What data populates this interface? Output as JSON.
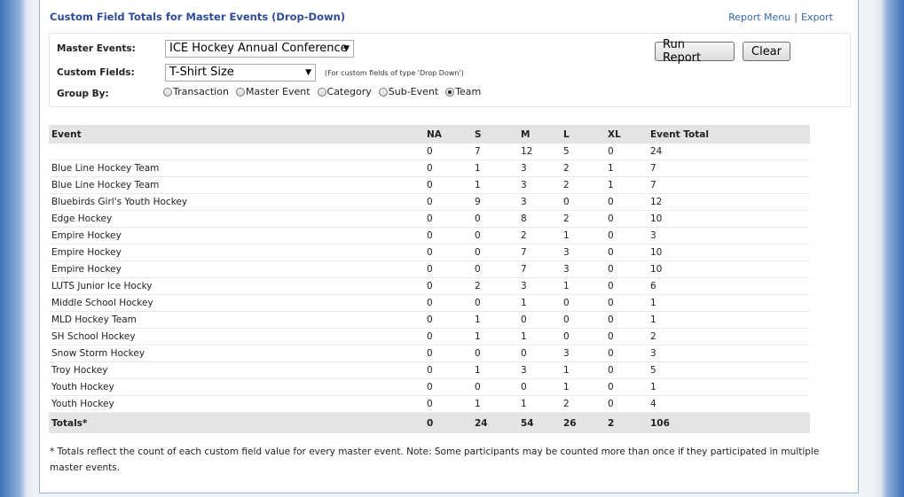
{
  "header": {
    "title": "Custom Field Totals for Master Events (Drop-Down)",
    "report_menu": "Report Menu",
    "separator": "|",
    "export": "Export"
  },
  "filters": {
    "master_events_label": "Master Events:",
    "master_events_value": "ICE Hockey Annual Conference",
    "custom_fields_label": "Custom Fields:",
    "custom_fields_value": "T-Shirt Size",
    "custom_fields_note": "(For custom fields of type 'Drop Down')",
    "group_by_label": "Group By:",
    "group_by_options": [
      "Transaction",
      "Master Event",
      "Category",
      "Sub-Event",
      "Team"
    ],
    "group_by_selected": "Team",
    "run_report": "Run Report",
    "clear": "Clear"
  },
  "table": {
    "columns": [
      "Event",
      "NA",
      "S",
      "M",
      "L",
      "XL",
      "Event Total"
    ],
    "rows": [
      [
        "",
        "0",
        "7",
        "12",
        "5",
        "0",
        "24"
      ],
      [
        "Blue Line Hockey Team",
        "0",
        "1",
        "3",
        "2",
        "1",
        "7"
      ],
      [
        "Blue Line Hockey Team",
        "0",
        "1",
        "3",
        "2",
        "1",
        "7"
      ],
      [
        "Bluebirds Girl's Youth Hockey",
        "0",
        "9",
        "3",
        "0",
        "0",
        "12"
      ],
      [
        "Edge Hockey",
        "0",
        "0",
        "8",
        "2",
        "0",
        "10"
      ],
      [
        "Empire Hockey",
        "0",
        "0",
        "2",
        "1",
        "0",
        "3"
      ],
      [
        "Empire Hockey",
        "0",
        "0",
        "7",
        "3",
        "0",
        "10"
      ],
      [
        "Empire Hockey",
        "0",
        "0",
        "7",
        "3",
        "0",
        "10"
      ],
      [
        "LUTS Junior Ice Hocky",
        "0",
        "2",
        "3",
        "1",
        "0",
        "6"
      ],
      [
        "Middle School Hockey",
        "0",
        "0",
        "1",
        "0",
        "0",
        "1"
      ],
      [
        "MLD Hockey Team",
        "0",
        "1",
        "0",
        "0",
        "0",
        "1"
      ],
      [
        "SH School Hockey",
        "0",
        "1",
        "1",
        "0",
        "0",
        "2"
      ],
      [
        "Snow Storm Hockey",
        "0",
        "0",
        "0",
        "3",
        "0",
        "3"
      ],
      [
        "Troy Hockey",
        "0",
        "1",
        "3",
        "1",
        "0",
        "5"
      ],
      [
        "Youth Hockey",
        "0",
        "0",
        "0",
        "1",
        "0",
        "1"
      ],
      [
        "Youth Hockey",
        "0",
        "1",
        "1",
        "2",
        "0",
        "4"
      ]
    ],
    "totals": [
      "Totals*",
      "0",
      "24",
      "54",
      "26",
      "2",
      "106"
    ]
  },
  "footnote": "* Totals reflect the count of each custom field value for every master event. Note: Some participants may be counted more than once if they participated in multiple master events."
}
